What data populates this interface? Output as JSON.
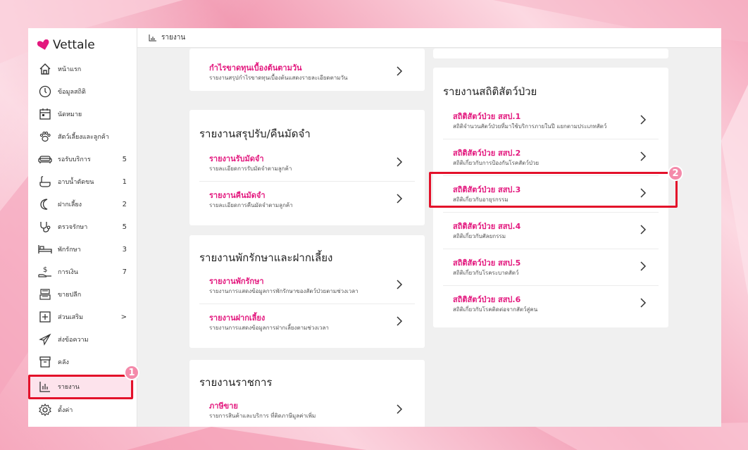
{
  "app": {
    "brand": "Vettale"
  },
  "breadcrumb": {
    "label": "รายงาน"
  },
  "sidebar": {
    "items": [
      {
        "label": "หน้าแรก",
        "count": ""
      },
      {
        "label": "ข้อมูลสถิติ",
        "count": ""
      },
      {
        "label": "นัดหมาย",
        "count": ""
      },
      {
        "label": "สัตว์เลี้ยงและลูกค้า",
        "count": ""
      },
      {
        "label": "รอรับบริการ",
        "count": "5"
      },
      {
        "label": "อาบน้ำตัดขน",
        "count": "1"
      },
      {
        "label": "ฝากเลี้ยง",
        "count": "2"
      },
      {
        "label": "ตรวจรักษา",
        "count": "5"
      },
      {
        "label": "พักรักษา",
        "count": "3"
      },
      {
        "label": "การเงิน",
        "count": "7"
      },
      {
        "label": "ขายปลีก",
        "count": ""
      },
      {
        "label": "ส่วนเสริม",
        "count": ">"
      },
      {
        "label": "ส่งข้อความ",
        "count": ""
      },
      {
        "label": "คลัง",
        "count": ""
      },
      {
        "label": "รายงาน",
        "count": ""
      },
      {
        "label": "ตั้งค่า",
        "count": ""
      }
    ]
  },
  "annotations": {
    "step1": "1",
    "step2": "2"
  },
  "left_column": {
    "top_card": {
      "rows": [
        {
          "title": "กำไรขาดทุนเบื้องต้นตามวัน",
          "desc": "รายงานสรุปกำไรขาดทุนเบื้องต้นแสดงรายละเอียดตามวัน"
        }
      ]
    },
    "deposit_card": {
      "title": "รายงานสรุปรับ/คืนมัดจำ",
      "rows": [
        {
          "title": "รายงานรับมัดจำ",
          "desc": "รายละเอียดการรับมัดจำตามลูกค้า"
        },
        {
          "title": "รายงานคืนมัดจำ",
          "desc": "รายละเอียดการคืนมัดจำตามลูกค้า"
        }
      ]
    },
    "boarding_card": {
      "title": "รายงานพักรักษาและฝากเลี้ยง",
      "rows": [
        {
          "title": "รายงานพักรักษา",
          "desc": "รายงานการแสดงข้อมูลการพักรักษาของสัตว์ป่วยตามช่วงเวลา"
        },
        {
          "title": "รายงานฝากเลี้ยง",
          "desc": "รายงานการแสดงข้อมูลการฝากเลี้ยงตามช่วงเวลา"
        }
      ]
    },
    "gov_card": {
      "title": "รายงานราชการ",
      "rows": [
        {
          "title": "ภาษีขาย",
          "desc": "รายการสินค้าและบริการ ที่ติดภาษีมูลค่าเพิ่ม"
        }
      ]
    }
  },
  "right_column": {
    "stats_card": {
      "title": "รายงานสถิติสัตว์ป่วย",
      "rows": [
        {
          "title": "สถิติสัตว์ป่วย สสป.1",
          "desc": "สถิติจำนวนสัตว์ป่วยที่มาใช้บริการภายในปี แยกตามประเภทสัตว์"
        },
        {
          "title": "สถิติสัตว์ป่วย สสป.2",
          "desc": "สถิติเกี่ยวกับการป้องกันโรคสัตว์ป่วย"
        },
        {
          "title": "สถิติสัตว์ป่วย สสป.3",
          "desc": "สถิติเกี่ยวกับอายุรกรรม"
        },
        {
          "title": "สถิติสัตว์ป่วย สสป.4",
          "desc": "สถิติเกี่ยวกับศัลยกรรม"
        },
        {
          "title": "สถิติสัตว์ป่วย สสป.5",
          "desc": "สถิติเกี่ยวกับโรคระบาดสัตว์"
        },
        {
          "title": "สถิติสัตว์ป่วย สสป.6",
          "desc": "สถิติเกี่ยวกับโรคติดต่อจากสัตว์สู่คน"
        }
      ]
    }
  },
  "colors": {
    "accent": "#e3187e",
    "highlight": "#e3112a",
    "badge": "#f48aaa"
  }
}
